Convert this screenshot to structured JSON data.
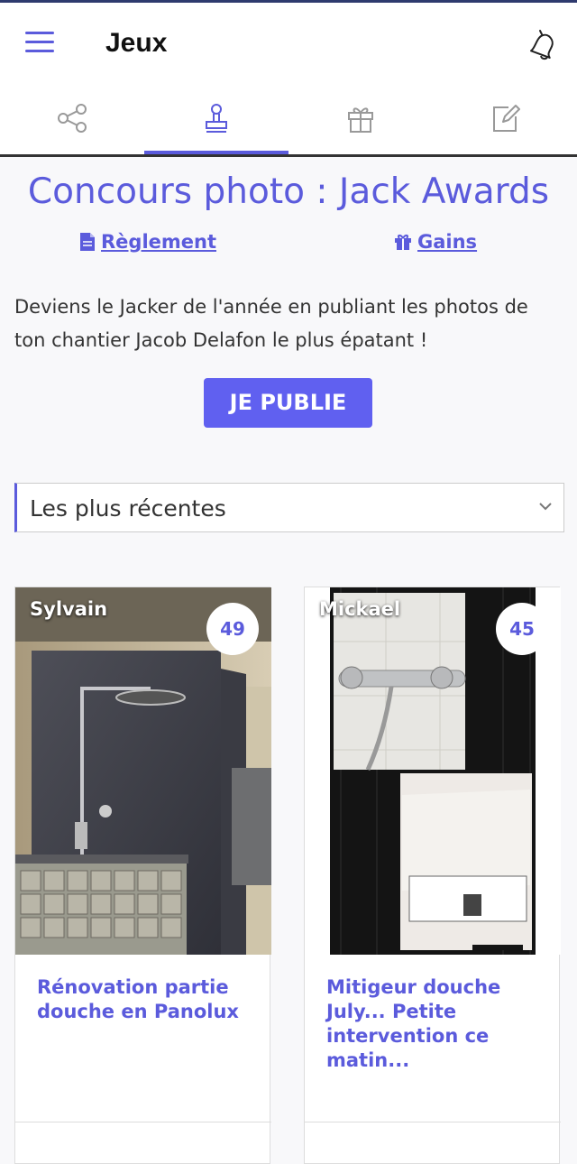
{
  "header": {
    "title": "Jeux"
  },
  "tabs": [
    {
      "icon": "share-icon"
    },
    {
      "icon": "stamp-icon",
      "active": true
    },
    {
      "icon": "gift-icon"
    },
    {
      "icon": "edit-icon"
    }
  ],
  "contest": {
    "title": "Concours photo : Jack Awards",
    "rules_link": "Règlement",
    "prizes_link": "Gains",
    "description": "Deviens le Jacker de l'année en publiant les photos de ton chantier Jacob Delafon le plus épatant !",
    "publish_button": "JE PUBLIE"
  },
  "sort": {
    "value": "Les plus récentes"
  },
  "cards": [
    {
      "author": "Sylvain",
      "score": "49",
      "caption": "Rénovation partie douche en Panolux"
    },
    {
      "author": "Mickael",
      "score": "45",
      "caption": "Mitigeur douche July... Petite intervention ce matin..."
    }
  ],
  "colors": {
    "accent": "#5b5bdc",
    "button": "#6060f0"
  }
}
